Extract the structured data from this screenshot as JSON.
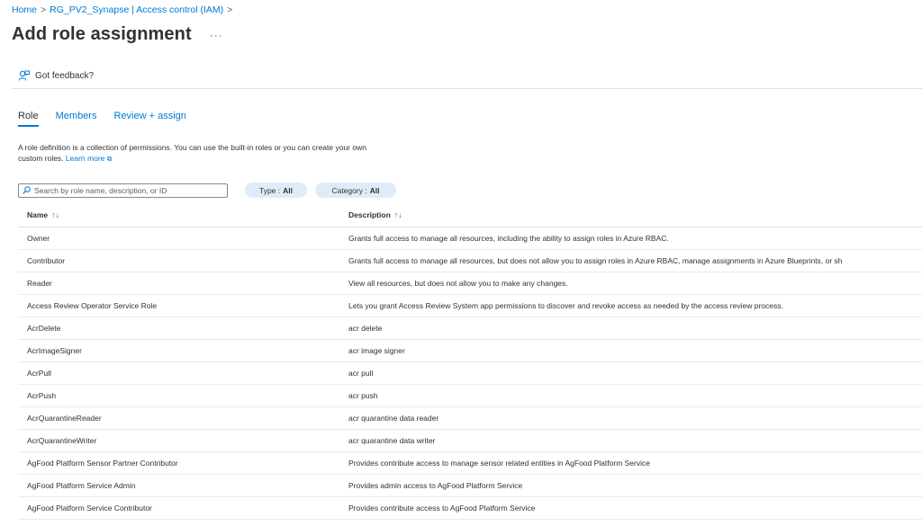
{
  "breadcrumb": {
    "home": "Home",
    "resource": "RG_PV2_Synapse | Access control (IAM)",
    "sep": ">"
  },
  "header": {
    "title": "Add role assignment",
    "more": "···"
  },
  "feedback": {
    "label": "Got feedback?",
    "icon": "feedback-person-icon"
  },
  "tabs": [
    {
      "label": "Role",
      "active": true
    },
    {
      "label": "Members",
      "active": false
    },
    {
      "label": "Review + assign",
      "active": false
    }
  ],
  "description": {
    "line1": "A role definition is a collection of permissions. You can use the built-in roles or you can create your own",
    "line2": "custom roles.",
    "learn_more": "Learn more"
  },
  "search": {
    "placeholder": "Search by role name, description, or ID",
    "value": ""
  },
  "filters": {
    "type_label": "Type :",
    "type_value": "All",
    "category_label": "Category :",
    "category_value": "All"
  },
  "table": {
    "columns": [
      "Name",
      "Description"
    ],
    "rows": [
      {
        "name": "Owner",
        "description": "Grants full access to manage all resources, including the ability to assign roles in Azure RBAC."
      },
      {
        "name": "Contributor",
        "description": "Grants full access to manage all resources, but does not allow you to assign roles in Azure RBAC, manage assignments in Azure Blueprints, or sh"
      },
      {
        "name": "Reader",
        "description": "View all resources, but does not allow you to make any changes."
      },
      {
        "name": "Access Review Operator Service Role",
        "description": "Lets you grant Access Review System app permissions to discover and revoke access as needed by the access review process."
      },
      {
        "name": "AcrDelete",
        "description": "acr delete"
      },
      {
        "name": "AcrImageSigner",
        "description": "acr image signer"
      },
      {
        "name": "AcrPull",
        "description": "acr pull"
      },
      {
        "name": "AcrPush",
        "description": "acr push"
      },
      {
        "name": "AcrQuarantineReader",
        "description": "acr quarantine data reader"
      },
      {
        "name": "AcrQuarantineWriter",
        "description": "acr quarantine data writer"
      },
      {
        "name": "AgFood Platform Sensor Partner Contributor",
        "description": "Provides contribute access to manage sensor related entities in AgFood Platform Service"
      },
      {
        "name": "AgFood Platform Service Admin",
        "description": "Provides admin access to AgFood Platform Service"
      },
      {
        "name": "AgFood Platform Service Contributor",
        "description": "Provides contribute access to AgFood Platform Service"
      }
    ]
  },
  "colors": {
    "accent": "#0078d4",
    "pill_bg": "#deecf9",
    "text": "#323130"
  }
}
